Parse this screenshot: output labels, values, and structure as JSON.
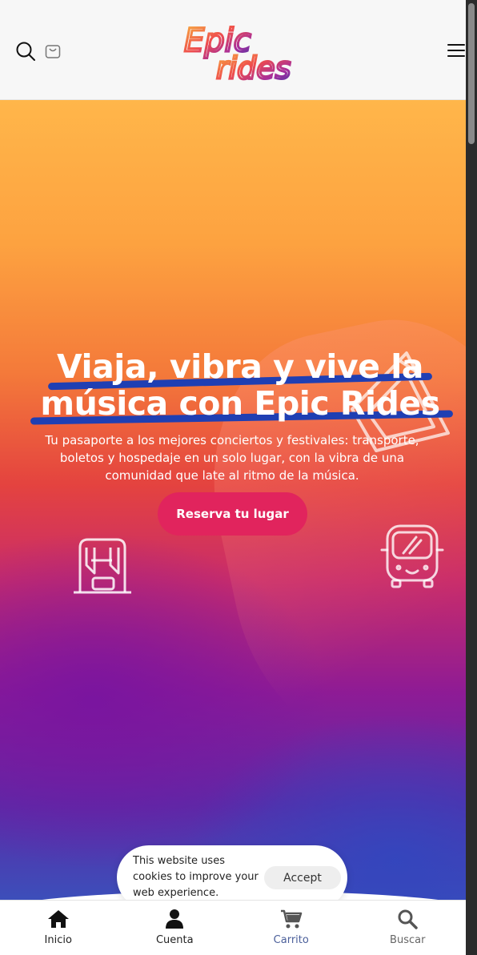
{
  "header": {
    "logo_text": "Epic rides",
    "icons": [
      "search-icon",
      "shopping-bag-icon",
      "menu-icon"
    ]
  },
  "hero": {
    "title_line1": "Viaja, vibra y vive la",
    "title_line2": "música con Epic Rides",
    "subtitle": "Tu pasaporte a los mejores conciertos y festivales: transporte, boletos y hospedaje en un solo lugar, con la vibra de una comunidad que late al ritmo de la música.",
    "cta_label": "Reserva tu lugar",
    "decorations": [
      "ticket-icon",
      "hotel-icon",
      "bus-icon"
    ]
  },
  "cookie": {
    "message": "This website uses cookies to improve your web experience.",
    "accept_label": "Accept"
  },
  "bottom_nav": {
    "items": [
      {
        "label": "Inicio",
        "icon": "home-icon"
      },
      {
        "label": "Cuenta",
        "icon": "user-icon"
      },
      {
        "label": "Carrito",
        "icon": "cart-icon"
      },
      {
        "label": "Buscar",
        "icon": "search-icon"
      }
    ]
  },
  "colors": {
    "cta": "#e1245d",
    "highlight_stroke": "#1f3fb3",
    "header_bg": "#f7f7f7"
  }
}
